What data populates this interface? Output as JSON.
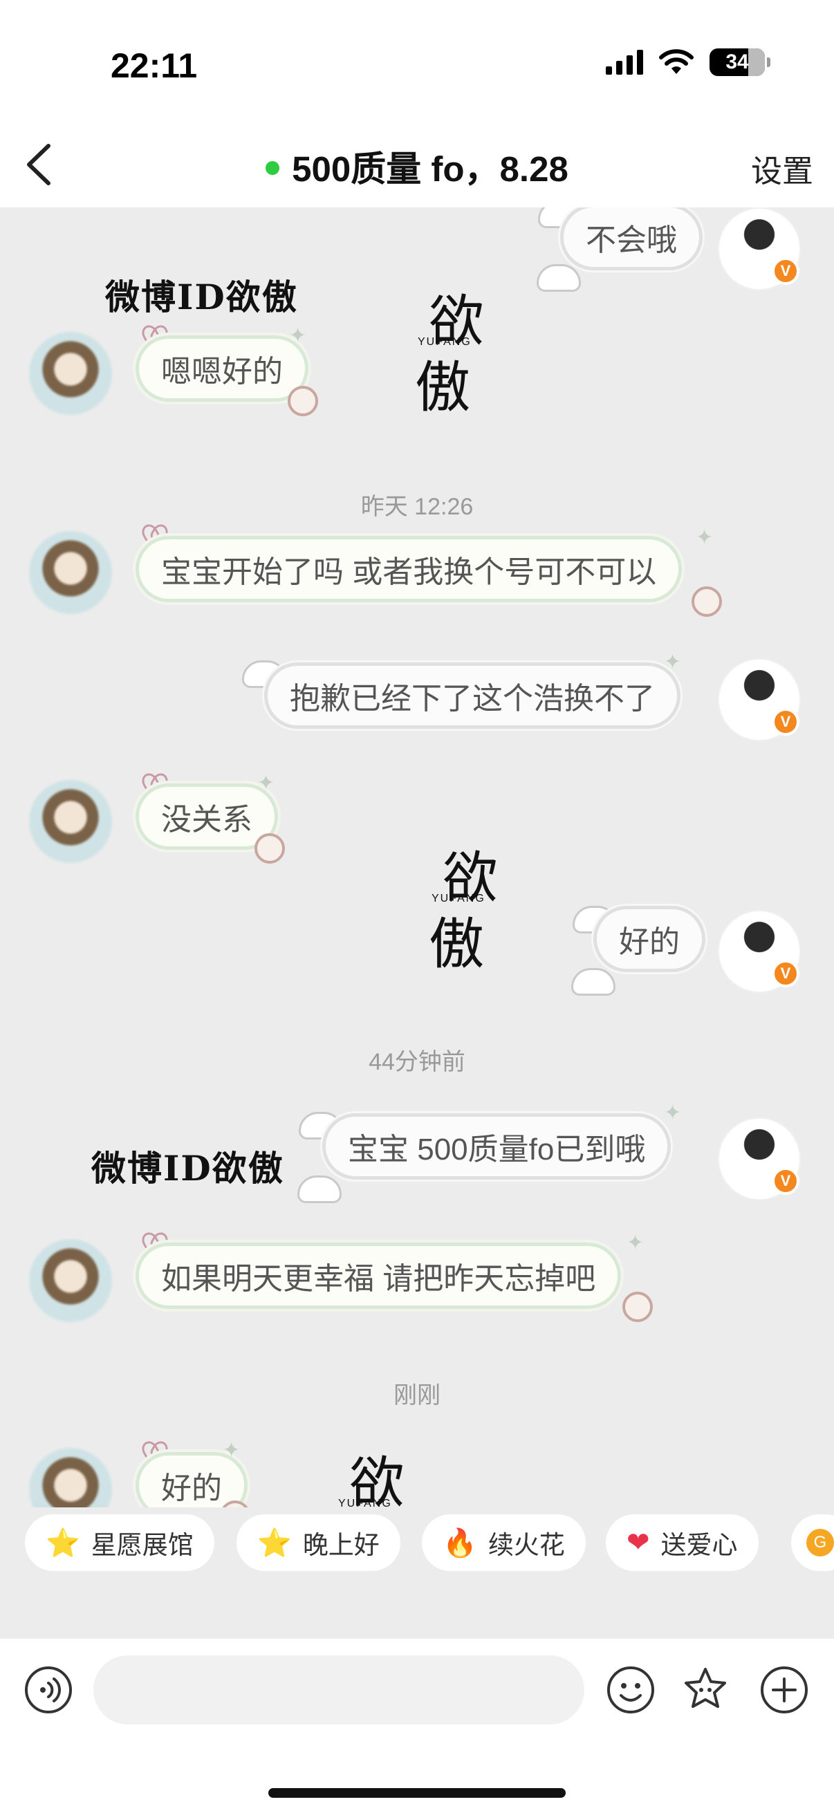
{
  "status_bar": {
    "time": "22:11",
    "battery": "34"
  },
  "header": {
    "title": "500质量 fo，8.28",
    "settings_label": "设置"
  },
  "chat": {
    "timestamps": {
      "yesterday": "昨天 12:26",
      "minutes_ago": "44分钟前",
      "just_now": "刚刚"
    },
    "messages": [
      {
        "side": "right",
        "text": "不会哦"
      },
      {
        "side": "left",
        "text": "嗯嗯好的"
      },
      {
        "side": "left",
        "text": "宝宝开始了吗 或者我换个号可不可以"
      },
      {
        "side": "right",
        "text": "抱歉已经下了这个浩换不了"
      },
      {
        "side": "left",
        "text": "没关系"
      },
      {
        "side": "right",
        "text": "好的"
      },
      {
        "side": "right",
        "text": "宝宝 500质量fo已到哦"
      },
      {
        "side": "left",
        "text": "如果明天更幸福 请把昨天忘掉吧"
      },
      {
        "side": "left",
        "text": "好的"
      }
    ],
    "watermarks": {
      "text": "微博ID欲傲",
      "logo_top": "欲",
      "logo_mid": "YUFANG",
      "logo_bottom": "傲"
    }
  },
  "quick_actions": [
    {
      "icon": "⭐",
      "label": "星愿展馆"
    },
    {
      "icon": "⭐",
      "label": "晚上好"
    },
    {
      "icon": "🔥",
      "label": "续火花"
    },
    {
      "icon": "❤",
      "label": "送爱心"
    },
    {
      "icon": "G",
      "label": ""
    }
  ],
  "input_bar": {
    "placeholder": ""
  },
  "colors": {
    "online": "#2ecc40",
    "verified": "#f5871f",
    "chat_background": "#ececec"
  }
}
